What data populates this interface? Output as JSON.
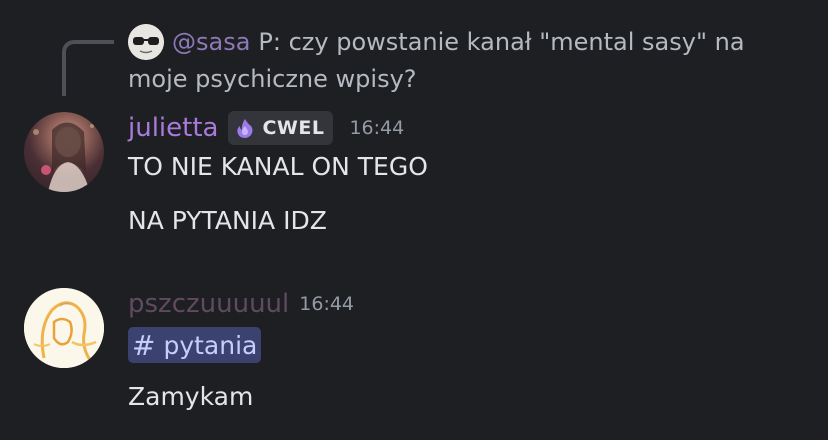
{
  "reply": {
    "author": "@sasa",
    "text": "P: czy powstanie kanał \"mental sasy\" na moje psychiczne wpisy?"
  },
  "messages": [
    {
      "username": "julietta",
      "badge": "CWEL",
      "time": "16:44",
      "lines": [
        "TO NIE KANAL ON TEGO",
        "NA PYTANIA IDZ"
      ]
    },
    {
      "username": "pszczuuuuul",
      "time": "16:44",
      "channel_mention": "pytania",
      "channel_icon": "#",
      "text": "Zamykam"
    }
  ],
  "colors": {
    "background": "#1e1f23",
    "username_julietta": "#a97ad9",
    "username_pszczu": "#5f4a5f",
    "mention_bg": "#3c4270"
  }
}
